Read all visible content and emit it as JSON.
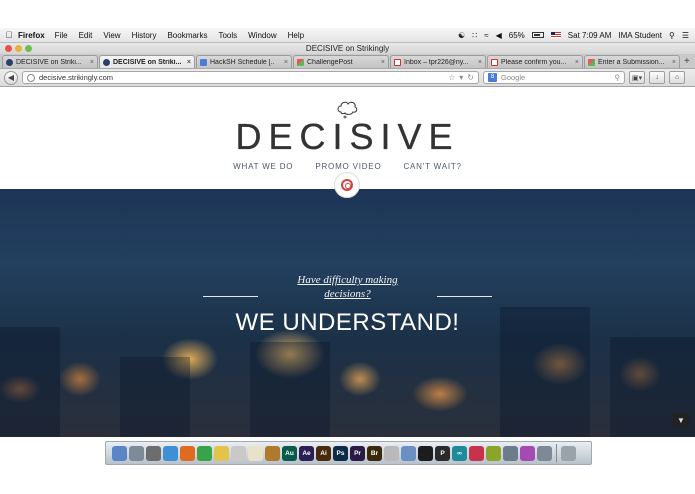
{
  "menubar": {
    "app": "Firefox",
    "items": [
      "File",
      "Edit",
      "View",
      "History",
      "Bookmarks",
      "Tools",
      "Window",
      "Help"
    ],
    "battery": "65%",
    "clock": "Sat 7:09 AM",
    "user": "IMA Student"
  },
  "window": {
    "title": "DECISIVE on Strikingly"
  },
  "tabs": [
    {
      "label": "DECISIVE on Striki...",
      "icon": "strikingly-icon",
      "active": false
    },
    {
      "label": "DECISIVE on Striki...",
      "icon": "strikingly-icon",
      "active": true
    },
    {
      "label": "HackSH Schedule [..",
      "icon": "doc-icon",
      "active": false
    },
    {
      "label": "ChallengePost",
      "icon": "challengepost-icon",
      "active": false
    },
    {
      "label": "Inbox – tpr226@ny...",
      "icon": "gmail-icon",
      "active": false
    },
    {
      "label": "Please confirm you...",
      "icon": "gmail-icon",
      "active": false
    },
    {
      "label": "Enter a Submission...",
      "icon": "challengepost-icon",
      "active": false
    }
  ],
  "navbar": {
    "url_host": "decisive.strikingly.com",
    "search_placeholder": "Google"
  },
  "site": {
    "brand": "DECISIVE",
    "nav": [
      "WHAT WE DO",
      "PROMO VIDEO",
      "CAN'T WAIT?"
    ],
    "tagline_line1": "Have difficulty making",
    "tagline_line2": "decisions?",
    "headline": "WE UNDERSTAND!"
  },
  "colors": {
    "accent": "#d8423b",
    "nav_text": "#4b5a6b",
    "hero_dark": "#1d3556"
  },
  "dock": {
    "icons": [
      {
        "name": "finder-icon",
        "color": "#5a86c8",
        "label": ""
      },
      {
        "name": "launchpad-icon",
        "color": "#7c8a99",
        "label": ""
      },
      {
        "name": "system-prefs-icon",
        "color": "#6d6d6d",
        "label": ""
      },
      {
        "name": "safari-icon",
        "color": "#3f8fd6",
        "label": ""
      },
      {
        "name": "firefox-icon",
        "color": "#e06a1e",
        "label": ""
      },
      {
        "name": "chrome-icon",
        "color": "#3aa34a",
        "label": ""
      },
      {
        "name": "cyberduck-icon",
        "color": "#e3c34a",
        "label": ""
      },
      {
        "name": "globe-app-icon",
        "color": "#c9c9c9",
        "label": ""
      },
      {
        "name": "star-app-icon",
        "color": "#e8e2c8",
        "label": ""
      },
      {
        "name": "guitar-app-icon",
        "color": "#b07a2e",
        "label": ""
      },
      {
        "name": "audition-icon",
        "color": "#0c5a4c",
        "label": "Au"
      },
      {
        "name": "after-effects-icon",
        "color": "#2b2055",
        "label": "Ae"
      },
      {
        "name": "illustrator-icon",
        "color": "#4a2a0c",
        "label": "Ai"
      },
      {
        "name": "photoshop-icon",
        "color": "#0d2a47",
        "label": "Ps"
      },
      {
        "name": "premiere-icon",
        "color": "#2b1a44",
        "label": "Pr"
      },
      {
        "name": "bridge-icon",
        "color": "#3a2a0c",
        "label": "Br"
      },
      {
        "name": "trophy-app-icon",
        "color": "#b9b9b9",
        "label": ""
      },
      {
        "name": "xcode-icon",
        "color": "#6a8fc2",
        "label": ""
      },
      {
        "name": "terminal-icon",
        "color": "#1c1c1c",
        "label": ""
      },
      {
        "name": "processing-icon",
        "color": "#2a2a2a",
        "label": "P"
      },
      {
        "name": "arduino-icon",
        "color": "#1f8a9a",
        "label": "∞"
      },
      {
        "name": "app-red-icon",
        "color": "#c8324a",
        "label": ""
      },
      {
        "name": "app-green-icon",
        "color": "#8aa52a",
        "label": ""
      },
      {
        "name": "preview-icon",
        "color": "#6c7c8c",
        "label": ""
      },
      {
        "name": "flower-app-icon",
        "color": "#a54ab2",
        "label": ""
      },
      {
        "name": "image-app-icon",
        "color": "#7d8a95",
        "label": ""
      },
      {
        "name": "trash-icon",
        "color": "#9aa3aa",
        "label": ""
      }
    ]
  }
}
